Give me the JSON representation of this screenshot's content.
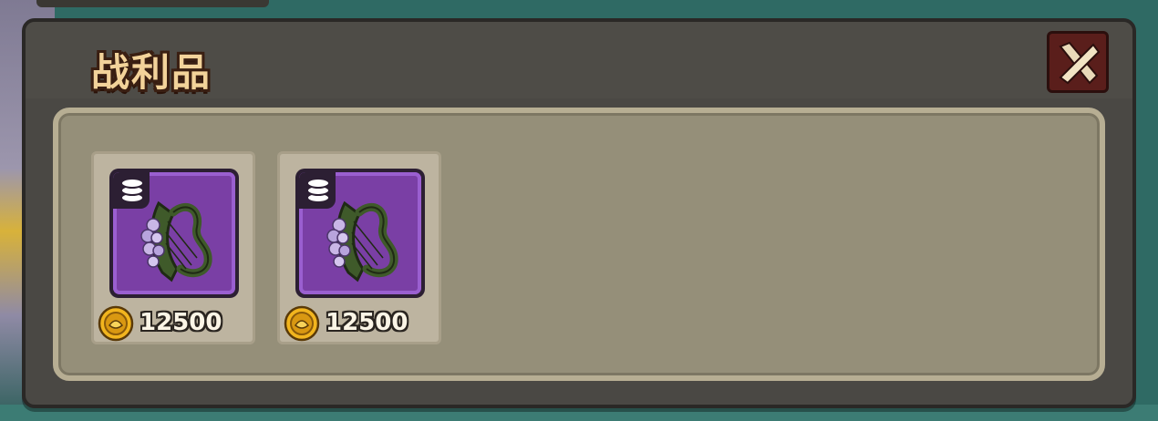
{
  "dialog": {
    "title": "战利品",
    "close_icon": "close-x-icon"
  },
  "colors": {
    "title_text": "#f3d39a",
    "item_rarity_purple": "#7a3fa5",
    "close_button": "#5a1e1b",
    "parchment": "#958f79"
  },
  "loot_items": [
    {
      "icon": "harp-icon",
      "rarity": "purple",
      "badge_icon": "coin-stack-icon",
      "currency_icon": "gold-coin-icon",
      "price": "12500"
    },
    {
      "icon": "harp-icon",
      "rarity": "purple",
      "badge_icon": "coin-stack-icon",
      "currency_icon": "gold-coin-icon",
      "price": "12500"
    }
  ]
}
